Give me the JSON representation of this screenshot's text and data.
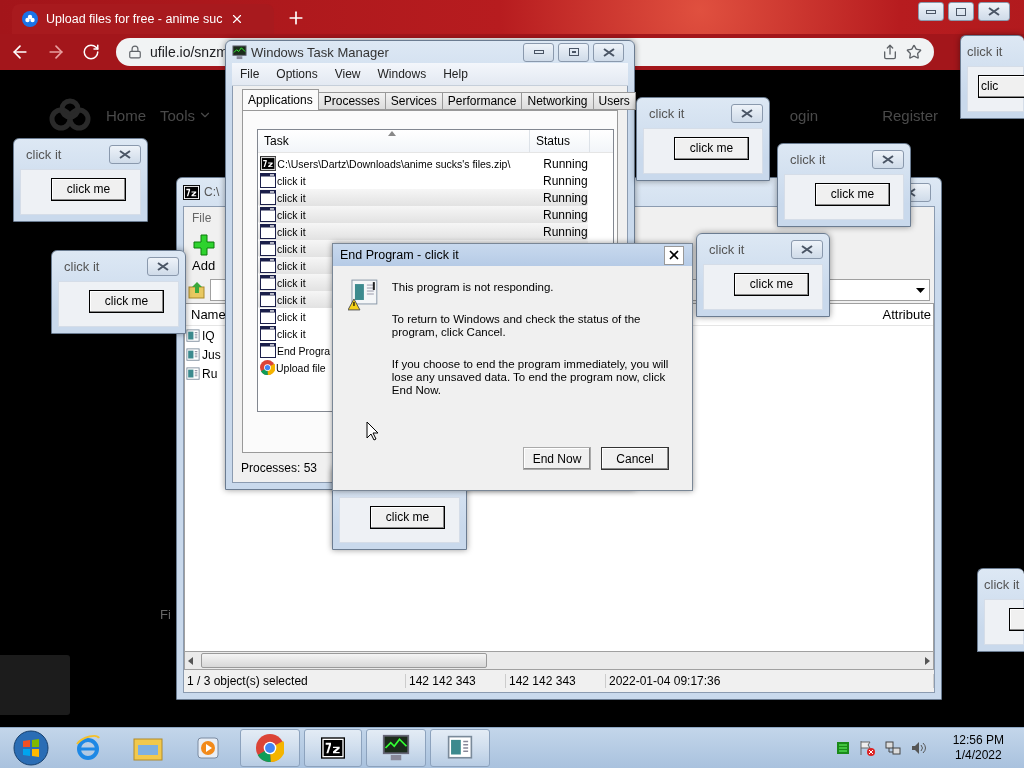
{
  "browser": {
    "tab_title": "Upload files for free - anime suc",
    "url": "ufile.io/snzm",
    "nav_left": [
      "Home",
      "Tools"
    ],
    "nav_right": [
      "ogin",
      "Register"
    ],
    "footer_text": "Fi"
  },
  "archive_window": {
    "title": "C:\\",
    "menu": [
      "File"
    ],
    "toolbar_button": "Add",
    "columns": [
      "Name",
      "Attribute"
    ],
    "files": [
      "IQ",
      "Jus",
      "Ru"
    ],
    "status": [
      "1 / 3 object(s) selected",
      "142 142 343",
      "142 142 343",
      "2022-01-04 09:17:36"
    ]
  },
  "task_manager": {
    "title": "Windows Task Manager",
    "menu": [
      "File",
      "Options",
      "View",
      "Windows",
      "Help"
    ],
    "tabs": [
      {
        "label": "Applications",
        "selected": true
      },
      {
        "label": "Processes",
        "selected": false
      },
      {
        "label": "Services",
        "selected": false
      },
      {
        "label": "Performance",
        "selected": false
      },
      {
        "label": "Networking",
        "selected": false
      },
      {
        "label": "Users",
        "selected": false
      }
    ],
    "columns": [
      "Task",
      "Status"
    ],
    "rows": [
      {
        "kind": "archive",
        "task": "C:\\Users\\Dartz\\Downloads\\anime sucks's files.zip\\",
        "status": "Running",
        "selected": false
      },
      {
        "kind": "window",
        "task": "click it",
        "status": "Running",
        "selected": false
      },
      {
        "kind": "window",
        "task": "click it",
        "status": "Running",
        "selected": true
      },
      {
        "kind": "window",
        "task": "click it",
        "status": "Running",
        "selected": true
      },
      {
        "kind": "window",
        "task": "click it",
        "status": "Running",
        "selected": true
      },
      {
        "kind": "window",
        "task": "click it",
        "selected": true
      },
      {
        "kind": "window",
        "task": "click it",
        "selected": true
      },
      {
        "kind": "window",
        "task": "click it",
        "selected": true
      },
      {
        "kind": "window",
        "task": "click it",
        "selected": true
      },
      {
        "kind": "window",
        "task": "click it",
        "selected": false
      },
      {
        "kind": "window",
        "task": "click it",
        "selected": false
      },
      {
        "kind": "window",
        "task": "End Progra",
        "selected": false
      },
      {
        "kind": "browser",
        "task": "Upload file",
        "selected": false
      }
    ],
    "processes": "Processes: 53"
  },
  "end_program_dialog": {
    "title": "End Program - click it",
    "paragraphs": [
      "This program is not responding.",
      "To return to Windows and check the status of the program, click Cancel.",
      "If you choose to end the program immediately, you will lose any unsaved data. To end the program now, click End Now."
    ],
    "buttons": [
      "End Now",
      "Cancel"
    ]
  },
  "popups": [
    {
      "title": "click it",
      "button": "click me"
    },
    {
      "title": "click it",
      "button": "click me"
    },
    {
      "title": "click it",
      "button": "click me"
    },
    {
      "title": "click it",
      "button": "click me"
    },
    {
      "title": "click it",
      "button": "click me"
    },
    {
      "title": "click it",
      "button": "clic"
    },
    {
      "title": "click it"
    },
    {
      "button": "click me"
    }
  ],
  "clock": {
    "time": "12:56 PM",
    "date": "1/4/2022"
  }
}
